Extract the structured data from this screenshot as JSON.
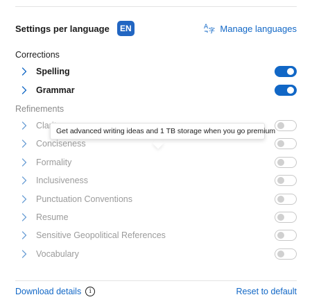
{
  "header": {
    "title": "Settings per language",
    "language_badge": "EN",
    "manage_languages_label": "Manage languages"
  },
  "sections": {
    "corrections_label": "Corrections",
    "refinements_label": "Refinements"
  },
  "corrections": [
    {
      "label": "Spelling",
      "enabled": true
    },
    {
      "label": "Grammar",
      "enabled": true
    }
  ],
  "refinements": [
    {
      "label": "Clarity",
      "enabled": false
    },
    {
      "label": "Conciseness",
      "enabled": false
    },
    {
      "label": "Formality",
      "enabled": false
    },
    {
      "label": "Inclusiveness",
      "enabled": false
    },
    {
      "label": "Punctuation Conventions",
      "enabled": false
    },
    {
      "label": "Resume",
      "enabled": false
    },
    {
      "label": "Sensitive Geopolitical References",
      "enabled": false
    },
    {
      "label": "Vocabulary",
      "enabled": false
    }
  ],
  "tooltip": {
    "text": "Get advanced writing ideas and 1 TB storage when you go premium"
  },
  "footer": {
    "download_details_label": "Download details",
    "info_glyph": "i",
    "reset_label": "Reset to default"
  },
  "colors": {
    "accent": "#1167c6",
    "badge": "#2266c2",
    "muted_text": "#9b9b9b"
  },
  "icons": {
    "manage_languages": "translate-icon",
    "row_expand": "chevron-right-icon",
    "download_info": "info-icon"
  }
}
